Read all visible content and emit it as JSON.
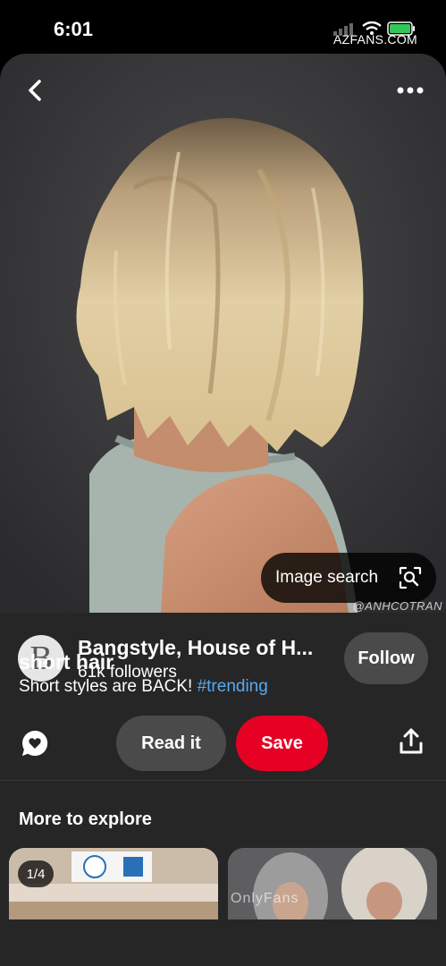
{
  "status_bar": {
    "time": "6:01",
    "watermark": "AZFANS.COM",
    "icons": [
      "signal-icon",
      "wifi-icon",
      "battery-icon"
    ]
  },
  "pin": {
    "photo_credit": "@ANHCOTRAN",
    "image_search_label": "Image search",
    "title": "short hair",
    "description_text": "Short styles are BACK! ",
    "description_hashtag": "#trending"
  },
  "creator": {
    "avatar_letter": "B",
    "name": "Bangstyle, House of H...",
    "followers": "61k followers",
    "follow_label": "Follow"
  },
  "actions": {
    "read_it_label": "Read it",
    "save_label": "Save"
  },
  "explore": {
    "title": "More to explore",
    "left_tile_badge": "1/4",
    "bottom_watermark": "OnlyFans"
  },
  "colors": {
    "background": "#262626",
    "save_red": "#e60023",
    "hashtag_blue": "#5aa8f0",
    "pill_gray": "#4a4a4a"
  }
}
